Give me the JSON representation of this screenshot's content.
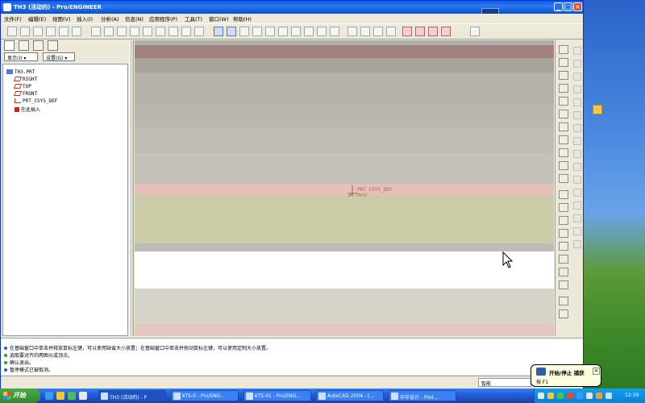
{
  "window": {
    "title": "TH3 (活动的) - Pro/ENGINEER"
  },
  "menu": [
    "文件(F)",
    "编辑(E)",
    "视图(V)",
    "插入(I)",
    "分析(A)",
    "信息(N)",
    "应用程序(P)",
    "工具(T)",
    "窗口(W)",
    "帮助(H)"
  ],
  "navigator": {
    "show_label": "显示(I) ▾",
    "settings_label": "设置(G) ▾",
    "tree": [
      {
        "label": "TH3.PRT",
        "icon": "part-icon"
      },
      {
        "label": "RIGHT",
        "icon": "datum-plane-icon"
      },
      {
        "label": "TOP",
        "icon": "datum-plane-icon"
      },
      {
        "label": "FRONT",
        "icon": "datum-plane-icon"
      },
      {
        "label": "PRT_CSYS_DEF",
        "icon": "csys-icon"
      },
      {
        "label": "在此插入",
        "icon": "insert-here-icon"
      }
    ]
  },
  "graphics": {
    "csys_label": "PRT_CSYS_DEF",
    "point_label": "PNT0",
    "axis_label": "X",
    "colors": {
      "band_rose": "#a3817e",
      "band_gray": "#b0aea8",
      "band_pink": "#e5c1ba",
      "band_olive": "#cdcca9",
      "band_white": "#ffffff",
      "band_light": "#d6d3c9"
    }
  },
  "messages": [
    {
      "text": "在基础窗口中单击并释放鼠标左键，可以使用缺省大小放置；在基础窗口中单击并拖动鼠标左键，可以使用定制大小放置。",
      "color": "#2a5fc8"
    },
    {
      "text": "选取要对齐的两图元或顶点。",
      "color": "#2a9a3a"
    },
    {
      "text": "确认退出。",
      "color": "#2a9a3a"
    },
    {
      "text": "暂停模式已被取消。",
      "color": "#2a5fc8"
    }
  ],
  "status": {
    "filter_value": "智能"
  },
  "balloon": {
    "title": "开始/停止 捕获",
    "shortcut": "按 F1"
  },
  "taskbar": {
    "start_label": "开始",
    "tasks": [
      "TH3 (活动的) - P",
      "KTS-0 - Pro/ENG...",
      "KTS-01 - Pro/ENG...",
      "AutoCAD 2004 - [...",
      "中华设计 - Prol..."
    ],
    "clock": "12:39"
  }
}
